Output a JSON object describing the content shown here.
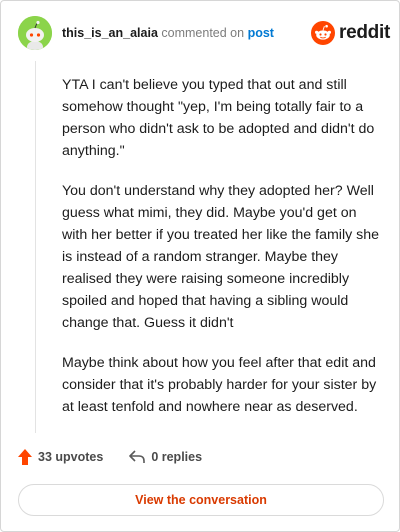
{
  "header": {
    "username": "this_is_an_alaia",
    "commented_on": "commented on",
    "post_link": "post",
    "logo_text": "reddit"
  },
  "comment": {
    "paragraphs": [
      "YTA I can't believe you typed that out and still somehow thought \"yep, I'm being totally fair to a person who didn't ask to be adopted and didn't do anything.\"",
      "You don't understand why they adopted her? Well guess what mimi, they did. Maybe you'd get on with her better if you treated her like the family she is instead of a random stranger. Maybe they realised they were raising someone incredibly spoiled and hoped that having a sibling would change that. Guess it didn't",
      "Maybe think about how you feel after that edit and consider that it's probably harder for your sister by at least tenfold and nowhere near as deserved."
    ]
  },
  "actions": {
    "upvotes": "33 upvotes",
    "replies": "0 replies"
  },
  "cta": {
    "label": "View the conversation"
  },
  "colors": {
    "accent": "#ff4500",
    "link": "#0079d3",
    "cta_text": "#d93a00",
    "avatar": "#8bd44a"
  },
  "icons": {
    "upvote": "arrow-up-icon",
    "reply": "reply-arrow-icon",
    "logo": "reddit-snoo-icon"
  }
}
